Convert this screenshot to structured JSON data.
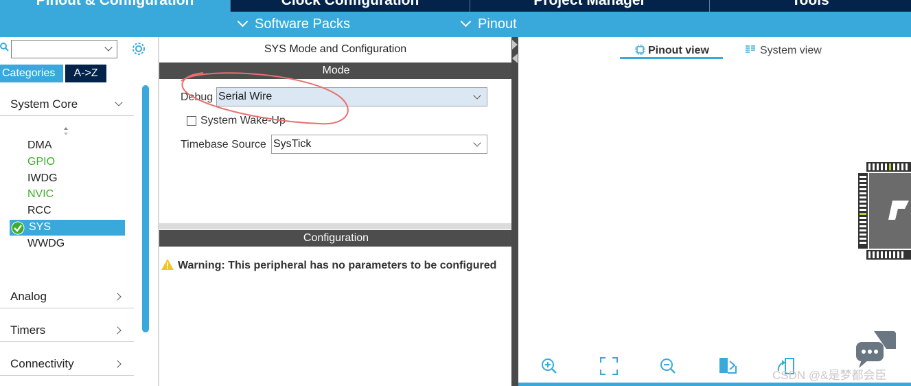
{
  "top_tabs": [
    "Pinout & Configuration",
    "Clock Configuration",
    "Project Manager",
    "Tools"
  ],
  "sub_bar": {
    "software_packs": "Software Packs",
    "pinout": "Pinout"
  },
  "sidebar": {
    "search_value": "",
    "categories_tab": "Categories",
    "az_tab": "A->Z",
    "group_system_core": "System Core",
    "peripherals": [
      {
        "label": "DMA",
        "status": "normal"
      },
      {
        "label": "GPIO",
        "status": "green"
      },
      {
        "label": "IWDG",
        "status": "normal"
      },
      {
        "label": "NVIC",
        "status": "green"
      },
      {
        "label": "RCC",
        "status": "normal"
      },
      {
        "label": "SYS",
        "status": "selected"
      },
      {
        "label": "WWDG",
        "status": "normal"
      }
    ],
    "groups": [
      "Analog",
      "Timers",
      "Connectivity"
    ]
  },
  "middle": {
    "title": "SYS Mode and Configuration",
    "mode_header": "Mode",
    "debug_label": "Debug",
    "debug_value": "Serial Wire",
    "wakeup_label": "System Wake-Up",
    "timebase_label": "Timebase Source",
    "timebase_value": "SysTick",
    "config_header": "Configuration",
    "warning": "Warning: This peripheral has no parameters to be configured"
  },
  "right": {
    "pinout_view": "Pinout view",
    "system_view": "System view",
    "watermark": "CSDN @&是梦都会臣"
  },
  "colors": {
    "accent": "#39a9db",
    "dark": "#03234b",
    "green": "#3dae2b",
    "header_grey": "#4d4d4d"
  }
}
